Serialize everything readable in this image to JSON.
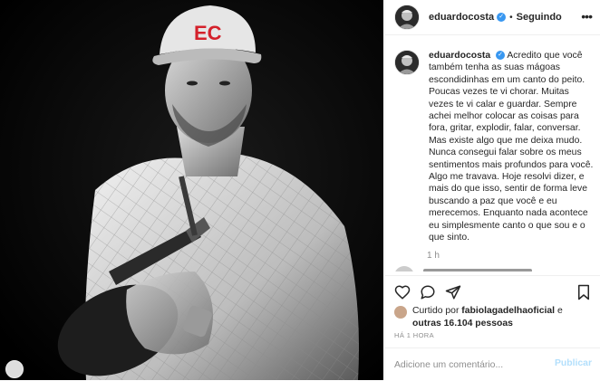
{
  "post": {
    "username": "eduardocosta",
    "verified": true,
    "follow_status": "Seguindo",
    "cap_logo_text": "EC"
  },
  "caption": {
    "username": "eduardocosta",
    "text": "Acredito que você também tenha as suas mágoas escondidinhas em um canto do peito. Poucas vezes te vi chorar. Muitas vezes te vi calar e guardar. Sempre achei melhor colocar as coisas para fora, gritar, explodir, falar, conversar. Mas existe algo que me deixa mudo. Nunca consegui falar sobre os meus sentimentos mais profundos para você. Algo me travava. Hoje resolvi dizer, e mais do que isso, sentir de forma leve buscando a paz que você e eu merecemos. Enquanto nada acontece eu simplesmente canto o que sou e o que sinto.",
    "time": "1 h"
  },
  "likes": {
    "prefix": "Curtido por",
    "user": "fabiolagadelhaoficial",
    "connector": "e",
    "others": "outras 16.104 pessoas"
  },
  "posted_time": "HÁ 1 HORA",
  "comment": {
    "placeholder": "Adicione um comentário...",
    "publish_label": "Publicar"
  },
  "icons": {
    "like": "heart-icon",
    "comment": "comment-icon",
    "share": "share-icon",
    "save": "bookmark-icon",
    "more": "more-options-icon",
    "verified": "verified-badge-icon"
  },
  "colors": {
    "accent": "#3897f0",
    "publish_disabled": "#b2dffc",
    "cap_logo": "#d4212b"
  }
}
